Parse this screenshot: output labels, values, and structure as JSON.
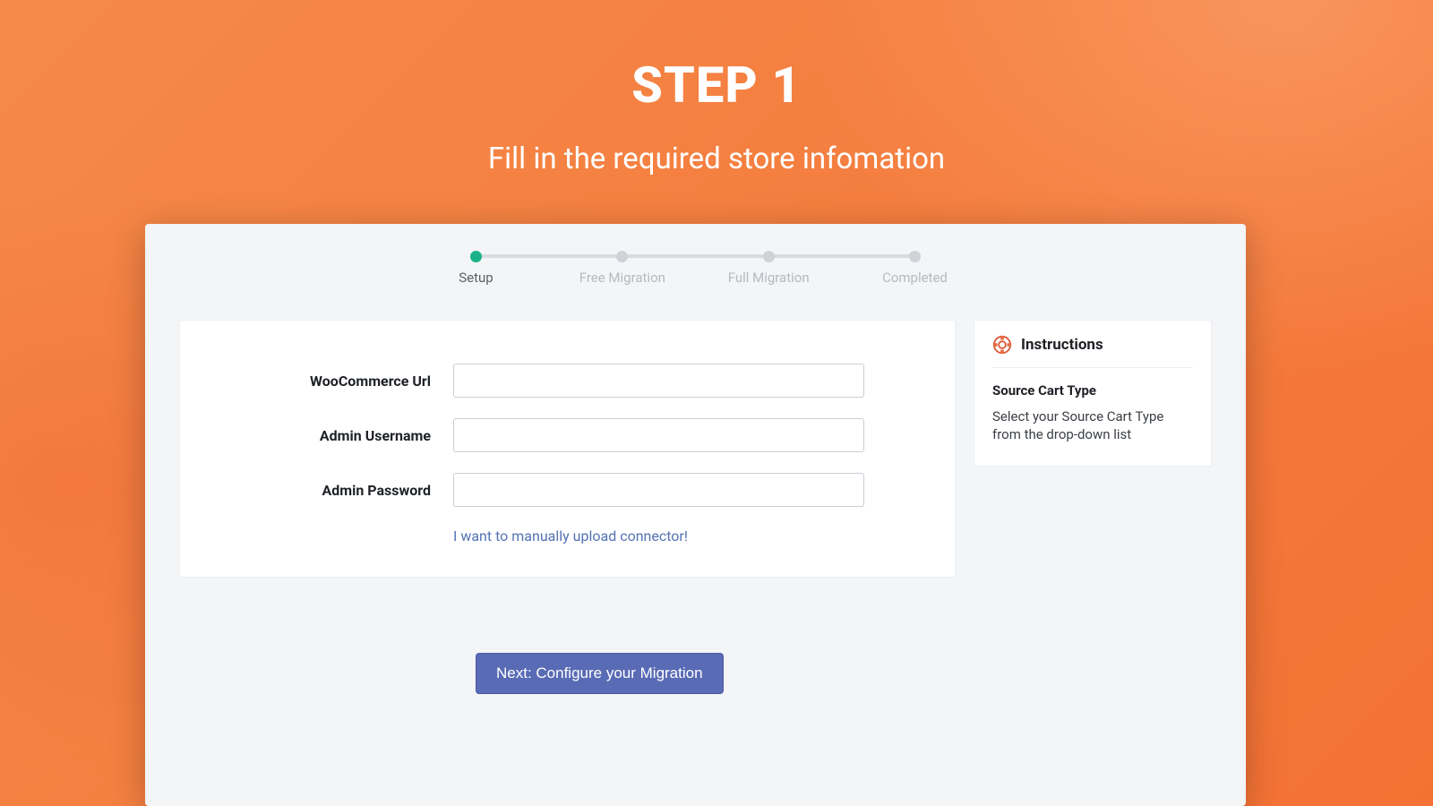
{
  "hero": {
    "title": "STEP 1",
    "subtitle": "Fill in the required store infomation"
  },
  "stepper": {
    "steps": [
      {
        "label": "Setup",
        "active": true
      },
      {
        "label": "Free Migration",
        "active": false
      },
      {
        "label": "Full Migration",
        "active": false
      },
      {
        "label": "Completed",
        "active": false
      }
    ]
  },
  "form": {
    "woocommerce_url": {
      "label": "WooCommerce Url",
      "value": ""
    },
    "admin_username": {
      "label": "Admin Username",
      "value": ""
    },
    "admin_password": {
      "label": "Admin Password",
      "value": ""
    },
    "manual_link": "I want to manually upload connector!"
  },
  "instructions": {
    "title": "Instructions",
    "subheading": "Source Cart Type",
    "text": "Select your Source Cart Type from the drop-down list"
  },
  "next_button": "Next: Configure your Migration",
  "colors": {
    "accent_orange": "#f47736",
    "active_green": "#1bb28a",
    "primary_button": "#5a6bb5",
    "link": "#5472b5"
  }
}
